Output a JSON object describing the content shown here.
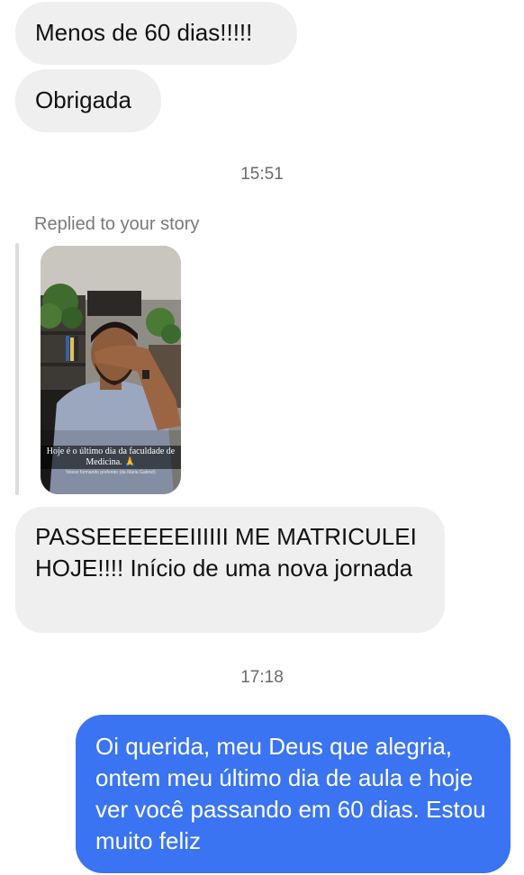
{
  "messages": {
    "m1": "Menos de 60 dias!!!!!",
    "m2": "Obrigada",
    "m3": "PASSEEEEEEIIIIII ME MATRICULEI HOJE!!!! Início de uma nova jornada",
    "m4": "Oi querida, meu Deus que alegria, ontem meu último dia de aula e hoje ver você passando em 60 dias. Estou muito feliz"
  },
  "timestamps": {
    "t1": "15:51",
    "t2": "17:18"
  },
  "reply": {
    "label": "Replied to your story"
  },
  "story": {
    "caption": "Hoje é o último dia da faculdade de Medicina. 🙏",
    "small_text": "Nosso formando preferido (da Maria Gabriel)"
  },
  "colors": {
    "incoming_bubble": "#efefef",
    "outgoing_bubble": "#3a74f2",
    "timestamp_text": "#6b6b6b"
  }
}
